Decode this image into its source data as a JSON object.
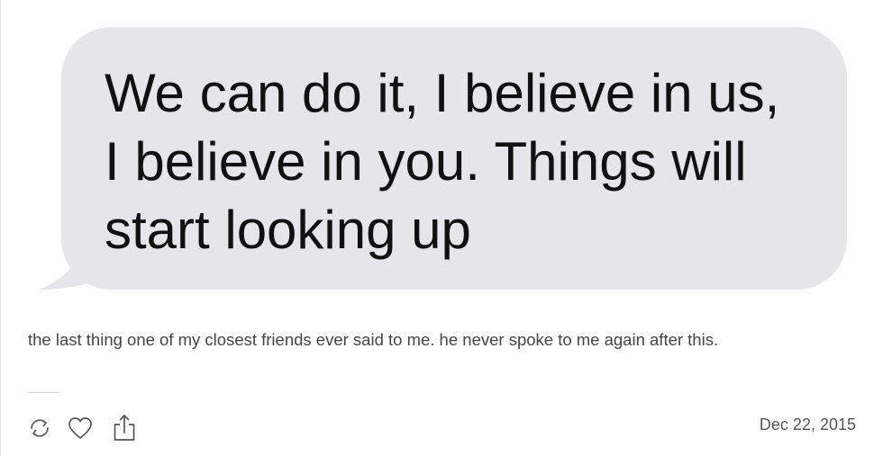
{
  "post": {
    "message_text": "We can do it, I believe in us, I believe in you. Things will start looking up",
    "caption": "the last thing one of my closest friends ever said to me. he never spoke to me again after this.",
    "date": "Dec 22, 2015"
  },
  "actions": [
    {
      "name": "reblog",
      "icon": "reblog-icon"
    },
    {
      "name": "like",
      "icon": "heart-icon"
    },
    {
      "name": "share",
      "icon": "share-icon"
    }
  ],
  "colors": {
    "bubble": "#e5e5ea",
    "message_text": "#111111",
    "caption_text": "#444444",
    "icon_stroke": "#555555"
  }
}
